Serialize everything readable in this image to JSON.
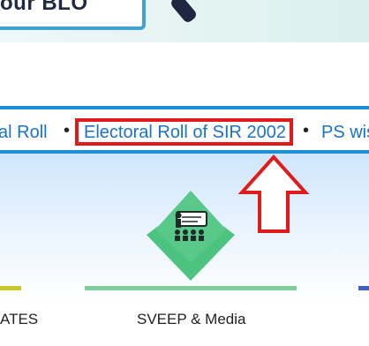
{
  "banner": {
    "search_text": "our BLO"
  },
  "ticker": {
    "items": [
      {
        "label": "al Roll"
      },
      {
        "label": "Electoral Roll of SIR 2002"
      },
      {
        "label": "PS wis"
      }
    ],
    "separator": "•"
  },
  "cards": [
    {
      "label": "ATES",
      "accent": "#c9c92a"
    },
    {
      "label": "SVEEP & Media",
      "accent": "#7fcf9a"
    },
    {
      "label": "",
      "accent": "#3f5fc4"
    }
  ],
  "colors": {
    "ticker_border": "#1e8fd4",
    "link": "#1a73c7",
    "highlight": "#e11b1b",
    "sveep_green": "#59c98a"
  },
  "icons": {
    "arrow": "up-arrow-icon",
    "sveep_logo": "sveep-logo-icon",
    "magnifier": "magnifier-icon"
  }
}
